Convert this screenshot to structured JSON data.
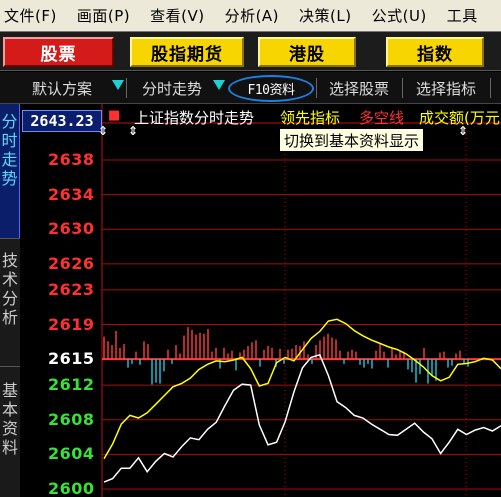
{
  "menu": {
    "items": [
      "文件(F)",
      "画面(P)",
      "查看(V)",
      "分析(A)",
      "决策(L)",
      "公式(U)",
      "工具"
    ]
  },
  "top_buttons": [
    {
      "label": "股票",
      "style": "red"
    },
    {
      "label": "股指期货",
      "style": "yellow"
    },
    {
      "label": "港股",
      "style": "yellow"
    },
    {
      "label": "指数",
      "style": "yellow"
    }
  ],
  "toolbar": {
    "default_scheme": "默认方案",
    "intraday": "分时走势",
    "f10": "F10资料",
    "select_stock": "选择股票",
    "select_indicator": "选择指标"
  },
  "side_tabs": {
    "intraday": "分时走势",
    "technical": "技术分析",
    "fundamental": "基本资料"
  },
  "chart_header": {
    "current_price": "2643.23",
    "title": "上证指数分时走势",
    "leading_indicator": "领先指标",
    "long_short_line": "多空线",
    "turnover": "成交额(万元)"
  },
  "tooltip": "切换到基本资料显示",
  "chart_data": {
    "type": "line",
    "title": "上证指数分时走势",
    "y_ticks": [
      "2638",
      "2634",
      "2630",
      "2626",
      "2623",
      "2619",
      "2615",
      "2612",
      "2608",
      "2604",
      "2600"
    ],
    "baseline": 2615,
    "ylim": [
      2600,
      2639
    ],
    "series": [
      {
        "name": "领先指标",
        "color": "#ffff00",
        "values": [
          2603.5,
          2605.2,
          2607.5,
          2608.5,
          2608.2,
          2608.8,
          2609.8,
          2610.8,
          2611.8,
          2612.2,
          2612.8,
          2613.8,
          2614.4,
          2614.8,
          2614.7,
          2614.9,
          2615.2,
          2613.9,
          2611.9,
          2612.2,
          2614.6,
          2615.2,
          2614.8,
          2616.1,
          2617.4,
          2618.2,
          2619.4,
          2619.6,
          2619.1,
          2618.3,
          2617.7,
          2617.2,
          2616.8,
          2616.4,
          2616.1,
          2615.6,
          2614.9,
          2614.1,
          2613.1,
          2612.5,
          2612.9,
          2614.4,
          2614.5,
          2614.7,
          2615.1,
          2614.9,
          2613.9
        ]
      },
      {
        "name": "上证指数",
        "color": "#ffffff",
        "values": [
          2600.8,
          2601.2,
          2602.4,
          2602.4,
          2603.6,
          2602.0,
          2603.2,
          2604.1,
          2603.7,
          2604.9,
          2605.9,
          2605.7,
          2606.9,
          2607.7,
          2609.6,
          2611.4,
          2612.1,
          2612.0,
          2607.4,
          2605.1,
          2605.4,
          2607.8,
          2611.2,
          2614.0,
          2615.2,
          2615.5,
          2613.1,
          2610.1,
          2609.4,
          2608.5,
          2608.2,
          2607.5,
          2606.9,
          2606.3,
          2606.2,
          2606.9,
          2607.6,
          2606.6,
          2605.8,
          2604.1,
          2605.4,
          2606.9,
          2606.3,
          2606.8,
          2607.1,
          2606.7,
          2607.3
        ]
      }
    ],
    "volume_bars": {
      "name": "成交额",
      "values": [
        2.4,
        1.9,
        1.5,
        3.0,
        1.2,
        1.6,
        -0.9,
        -0.5,
        0.8,
        -0.6,
        1.9,
        1.6,
        -2.7,
        -2.5,
        -2.6,
        -1.3,
        1.0,
        -0.5,
        1.5,
        0.6,
        2.5,
        3.4,
        3.1,
        2.6,
        2.8,
        2.7,
        3.2,
        0.8,
        1.2,
        -1.0,
        1.2,
        0.6,
        0.9,
        -1.2,
        0.7,
        1.0,
        1.4,
        1.8,
        2.0,
        -0.8,
        1.0,
        1.4,
        1.2,
        -0.8,
        1.1,
        -0.5,
        1.0,
        1.1,
        1.5,
        1.4,
        1.9,
        0.5,
        -0.5,
        1.5,
        2.0,
        2.4,
        2.7,
        2.3,
        2.1,
        0.9,
        -0.5,
        0.8,
        1.0,
        0.8,
        -0.6,
        -0.9,
        -0.5,
        -1.0,
        0.9,
        1.6,
        0.8,
        -0.9,
        1.2,
        0.5,
        0.8,
        0.8,
        -1.1,
        -1.4,
        -2.5,
        -1.6,
        1.2,
        -2.6,
        -1.8,
        -2.3,
        0.7,
        0.8,
        -0.9,
        -0.7,
        0.6,
        0.9,
        -0.5,
        -0.8
      ]
    }
  }
}
